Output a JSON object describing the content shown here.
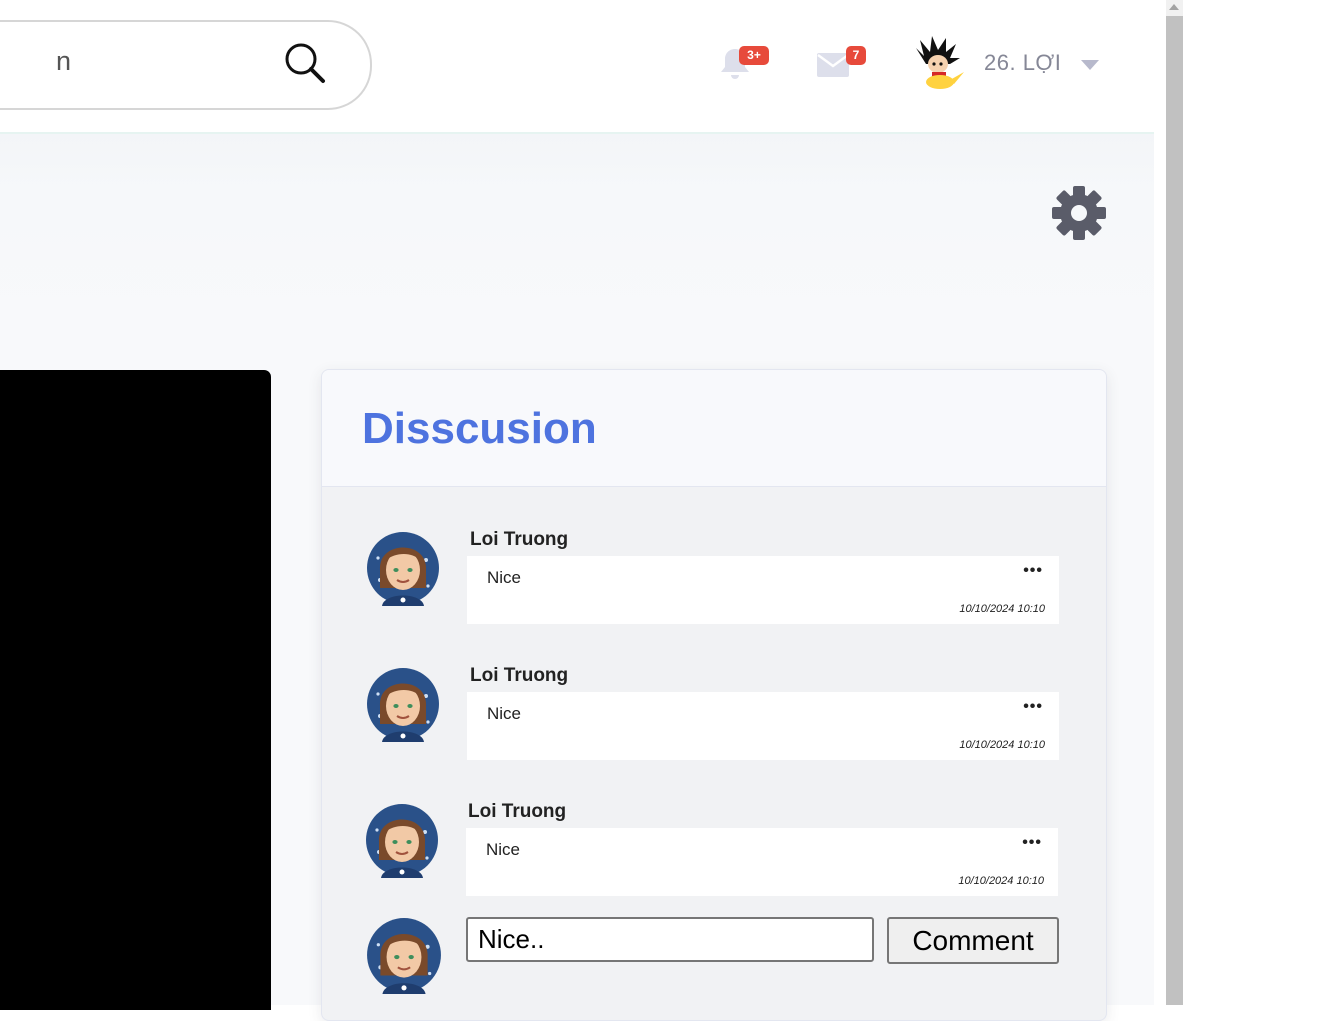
{
  "header": {
    "search_text": "n",
    "notifications_badge": "3+",
    "messages_badge": "7",
    "user_name": "26. LỢI"
  },
  "discussion": {
    "title": "Disscusion",
    "comments": [
      {
        "author": "Loi Truong",
        "text": "Nice",
        "more": "•••",
        "time": "10/10/2024 10:10"
      },
      {
        "author": "Loi Truong",
        "text": "Nice",
        "more": "•••",
        "time": "10/10/2024 10:10"
      },
      {
        "author": "Loi Truong",
        "text": "Nice",
        "more": "•••",
        "time": "10/10/2024 10:10"
      }
    ],
    "input_value": "Nice..",
    "submit_label": "Comment"
  },
  "colors": {
    "accent": "#4e73df",
    "badge": "#e74a3b",
    "muted": "#858796"
  }
}
